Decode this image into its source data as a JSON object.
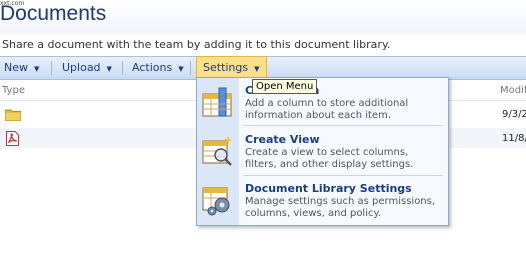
{
  "url_fragment": "xxt.com",
  "page": {
    "title": "Documents",
    "description": "Share a document with the team by adding it to this document library."
  },
  "toolbar": {
    "new_label": "New",
    "upload_label": "Upload",
    "actions_label": "Actions",
    "settings_label": "Settings"
  },
  "columns": {
    "type": "Type",
    "modified": "Modifi"
  },
  "rows": [
    {
      "icon": "folder-icon",
      "date": "9/3/2"
    },
    {
      "icon": "pdf-document-icon",
      "date": "11/8/"
    }
  ],
  "tooltip": "Open Menu",
  "settings_menu": {
    "items": [
      {
        "title": "Create Column",
        "visible_title": "C",
        "visible_title_end": "mn",
        "description": "Add a column to store additional information about each item.",
        "icon": "create-column-icon"
      },
      {
        "title": "Create View",
        "description": "Create a view to select columns, filters, and other display settings.",
        "icon": "create-view-icon"
      },
      {
        "title": "Document Library Settings",
        "description": "Manage settings such as permissions, columns, views, and policy.",
        "icon": "library-settings-icon"
      }
    ]
  },
  "colors": {
    "accent": "#1a3d80",
    "toolbar_bg": "#c9dbf2",
    "active_button": "#fbe08a",
    "folder": "#e7b93b",
    "pdf": "#c8302a"
  }
}
